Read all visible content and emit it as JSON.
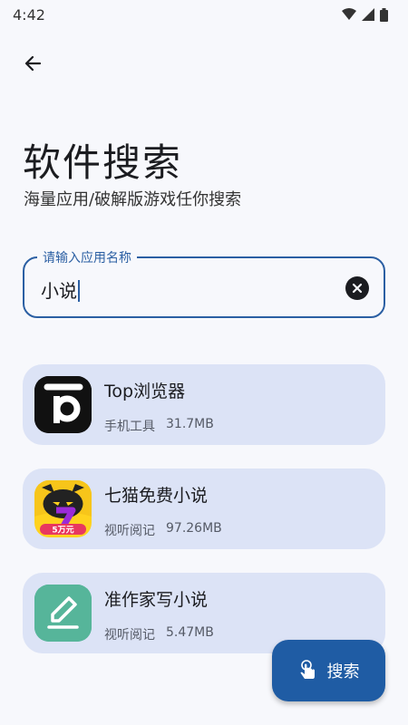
{
  "status": {
    "time": "4:42"
  },
  "header": {
    "title": "软件搜索",
    "subtitle": "海量应用/破解版游戏任你搜索"
  },
  "search": {
    "label": "请输入应用名称",
    "value": "小说"
  },
  "results": [
    {
      "name": "Top浏览器",
      "category": "手机工具",
      "size": "31.7MB",
      "icon": "top-browser-icon"
    },
    {
      "name": "七猫免费小说",
      "category": "视听阅记",
      "size": "97.26MB",
      "icon": "qimao-novel-icon",
      "badge": "5万元"
    },
    {
      "name": "准作家写小说",
      "category": "视听阅记",
      "size": "5.47MB",
      "icon": "pencil-edit-icon"
    }
  ],
  "fab": {
    "label": "搜索",
    "icon": "touch-icon"
  },
  "colors": {
    "accent": "#1f5ca4",
    "card": "#dce3f6",
    "background": "#f7f8fc"
  }
}
